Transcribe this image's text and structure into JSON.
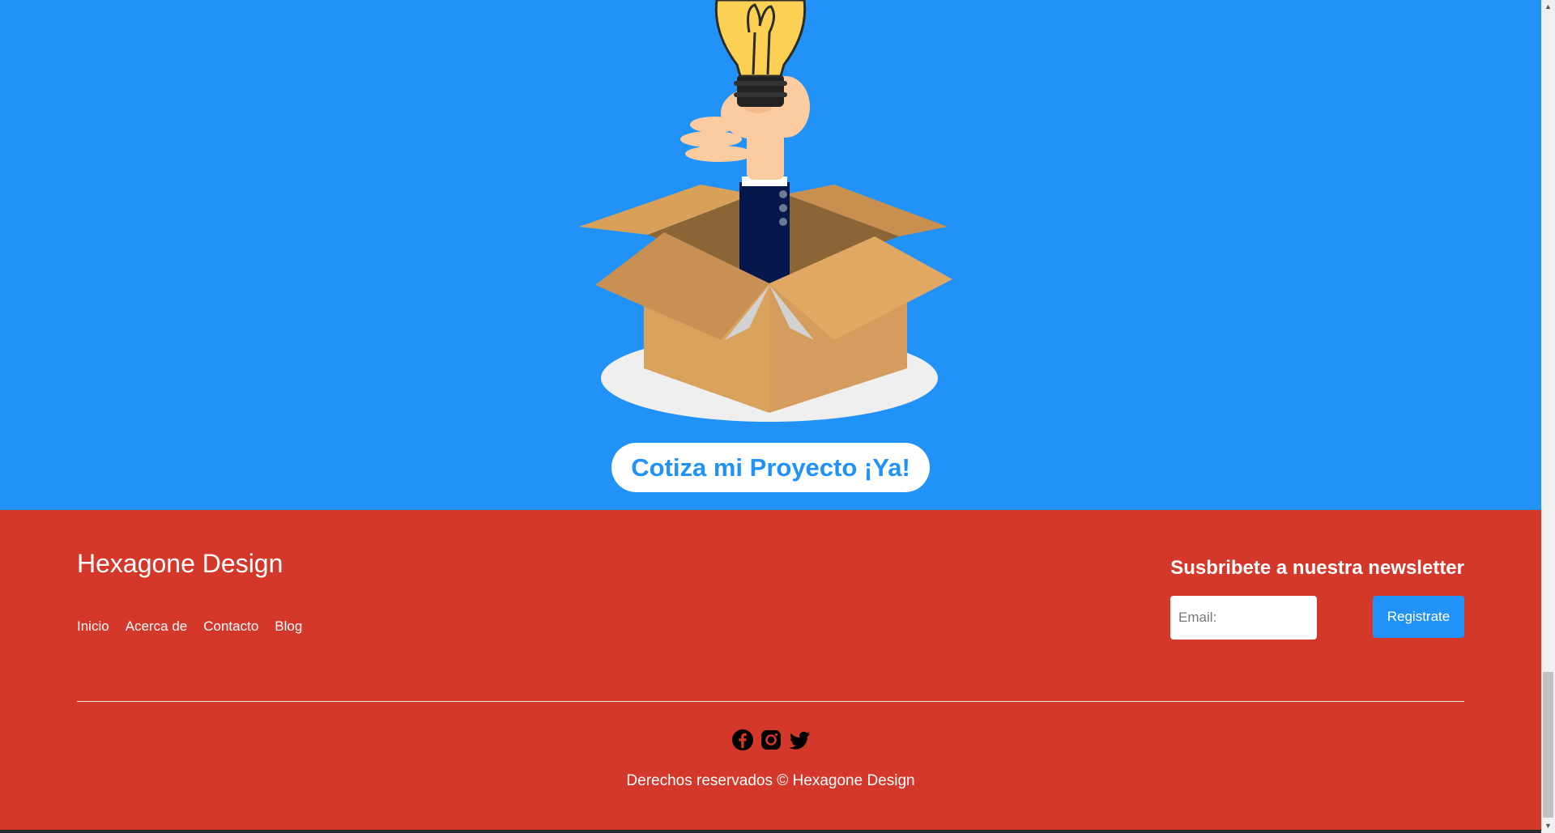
{
  "hero": {
    "cta_label": "Cotiza mi Proyecto ¡Ya!",
    "background_color": "#2192f8",
    "illustration": "hand-holding-lightbulb-from-box"
  },
  "footer": {
    "brand": "Hexagone Design",
    "nav": [
      "Inicio",
      "Acerca de",
      "Contacto",
      "Blog"
    ],
    "newsletter": {
      "title": "Susbribete a nuestra newsletter",
      "email_placeholder": "Email:",
      "button_label": "Registrate"
    },
    "social_icons": [
      "facebook-icon",
      "instagram-icon",
      "twitter-icon"
    ],
    "copyright": "Derechos reservados © Hexagone Design",
    "background_color": "#d3382a"
  }
}
